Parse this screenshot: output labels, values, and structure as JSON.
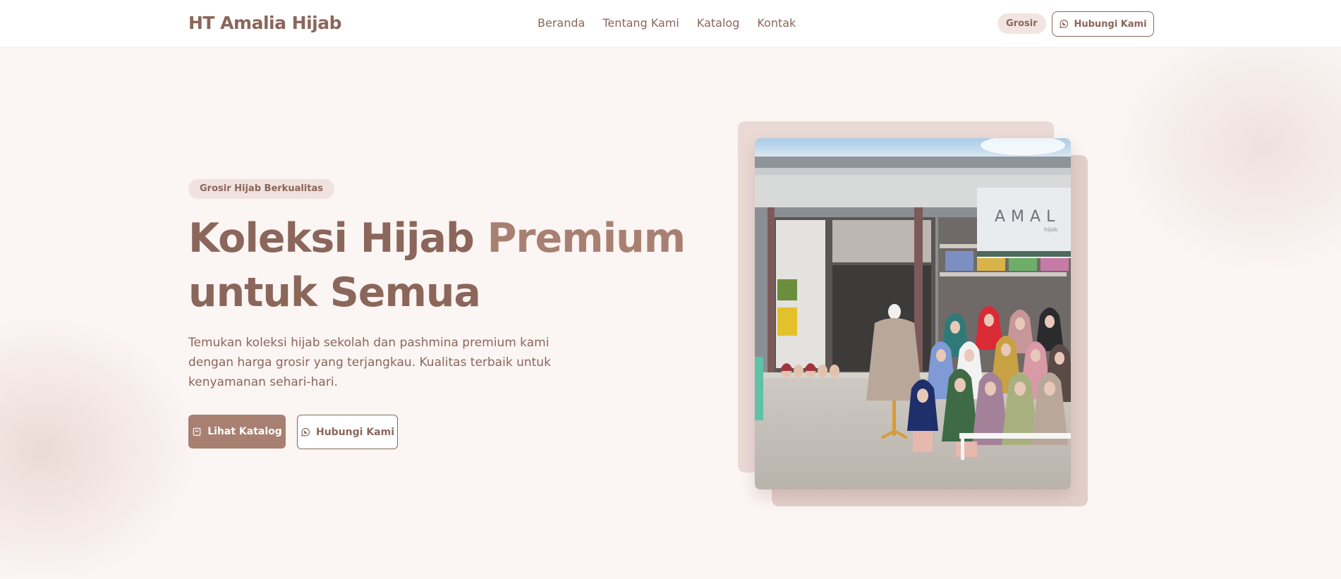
{
  "header": {
    "brand": "HT Amalia Hijab",
    "nav": [
      {
        "label": "Beranda"
      },
      {
        "label": "Tentang Kami"
      },
      {
        "label": "Katalog"
      },
      {
        "label": "Kontak"
      }
    ],
    "grosir_label": "Grosir",
    "contact_label": "Hubungi Kami",
    "contact_icon": "whatsapp-icon"
  },
  "hero": {
    "tag": "Grosir Hijab Berkualitas",
    "title_part1": "Koleksi Hijab ",
    "title_accent": "Premium",
    "title_part2": "untuk Semua",
    "description": "Temukan koleksi hijab sekolah dan pashmina premium kami dengan harga grosir yang terjangkau. Kualitas terbaik untuk kenyamanan sehari-hari.",
    "primary_button": {
      "label": "Lihat Katalog",
      "icon": "shopping-bag-icon"
    },
    "secondary_button": {
      "label": "Hubungi Kami",
      "icon": "whatsapp-icon"
    },
    "image": {
      "sign_text": "AMAL",
      "sign_subtext": "hijab"
    }
  },
  "colors": {
    "brand": "#8b665b",
    "accent": "#a88072",
    "hero_bg": "#fbf5f3",
    "pill_bg": "#f2e5e1",
    "frame_back": "#ead9d5",
    "frame_front": "#e3cfca"
  }
}
